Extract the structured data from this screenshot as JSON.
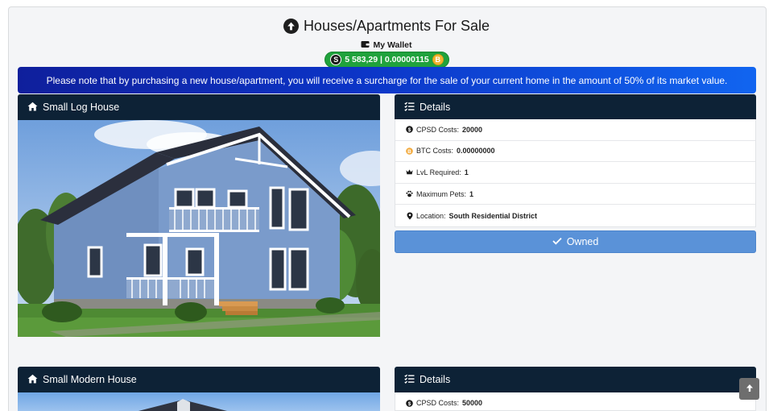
{
  "page": {
    "title": "Houses/Apartments For Sale"
  },
  "wallet": {
    "label": "My Wallet",
    "balance": "5 583,29 | 0.00000115",
    "coin_left_symbol": "S",
    "coin_right_symbol": "B"
  },
  "notice": "Please note that by purchasing a new house/apartment, you will receive a surcharge for the sale of your current home in the amount of 50% of its market value.",
  "listings": [
    {
      "name": "Small Log House",
      "details_title": "Details",
      "details": [
        {
          "icon": "dollar-icon",
          "label": "CPSD Costs:",
          "value": "20000"
        },
        {
          "icon": "bitcoin-icon",
          "label": "BTC Costs:",
          "value": "0.00000000"
        },
        {
          "icon": "crown-icon",
          "label": "LvL Required:",
          "value": "1"
        },
        {
          "icon": "paw-icon",
          "label": "Maximum Pets:",
          "value": "1"
        },
        {
          "icon": "map-marker-icon",
          "label": "Location:",
          "value": "South Residential District"
        }
      ],
      "action_label": "Owned"
    },
    {
      "name": "Small Modern House",
      "details_title": "Details",
      "details": [
        {
          "icon": "dollar-icon",
          "label": "CPSD Costs:",
          "value": "50000"
        }
      ]
    }
  ],
  "colors": {
    "header_bg": "#0d2236",
    "wallet_green": "#20a23c",
    "owned_blue": "#5a92d8",
    "banner_blue": "#0c34c6"
  }
}
